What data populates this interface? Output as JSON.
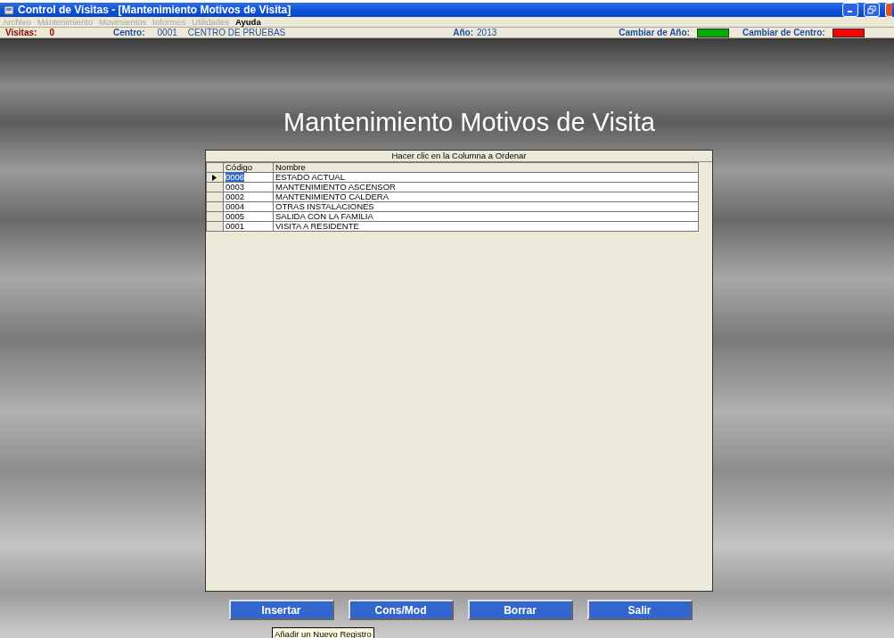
{
  "window": {
    "title": "Control de Visitas - [Mantenimiento Motivos de Visita]"
  },
  "menu": [
    {
      "label": "Archivo",
      "disabled": true
    },
    {
      "label": "Mantenimiento",
      "disabled": true
    },
    {
      "label": "Movimientos",
      "disabled": true
    },
    {
      "label": "Informes",
      "disabled": true
    },
    {
      "label": "Utilidades",
      "disabled": true
    },
    {
      "label": "Ayuda",
      "disabled": false
    }
  ],
  "status_bar": {
    "visitas_label": "Visitas:",
    "visitas_value": "0",
    "centro_label": "Centro:",
    "centro_code": "0001",
    "centro_name": "CENTRO DE PRUEBAS",
    "anio_label": "Año:",
    "anio_value": "2013",
    "indicators": [
      {
        "label": "Cambiar de Año:",
        "color": "#00b000"
      },
      {
        "label": "Cambiar de Centro:",
        "color": "#ff0000"
      }
    ]
  },
  "heading": "Mantenimiento Motivos de Visita",
  "table": {
    "caption": "Hacer clic en la Columna a Ordenar",
    "columns": [
      "Código",
      "Nombre"
    ],
    "rows": [
      {
        "code": "0006",
        "name": "ESTADO ACTUAL",
        "selected": true
      },
      {
        "code": "0003",
        "name": "MANTENIMIENTO ASCENSOR",
        "selected": false
      },
      {
        "code": "0002",
        "name": "MANTENIMIENTO CALDERA",
        "selected": false
      },
      {
        "code": "0004",
        "name": "OTRAS INSTALACIONES",
        "selected": false
      },
      {
        "code": "0005",
        "name": "SALIDA CON LA FAMILIA",
        "selected": false
      },
      {
        "code": "0001",
        "name": "VISITA A RESIDENTE",
        "selected": false
      }
    ]
  },
  "buttons": [
    "Insertar",
    "Cons/Mod",
    "Borrar",
    "Salir"
  ],
  "tooltip": "Añadir un Nuevo Registro"
}
